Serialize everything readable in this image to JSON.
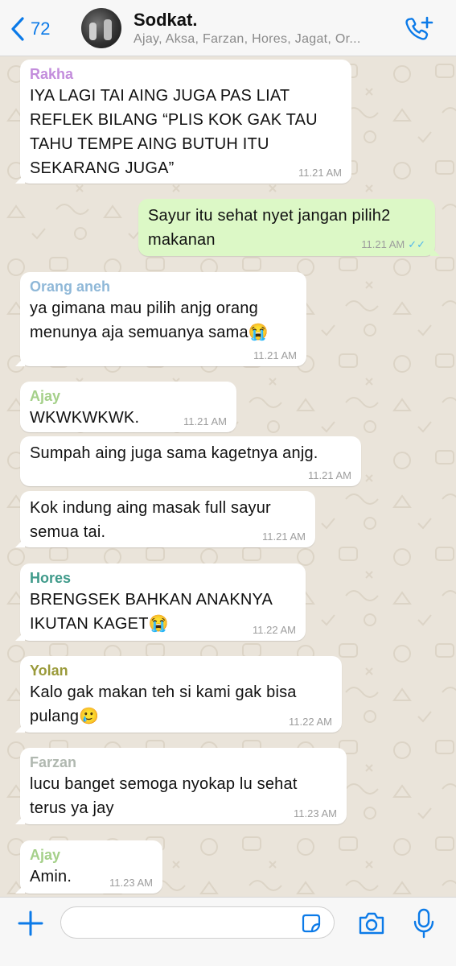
{
  "header": {
    "back_count": "72",
    "title": "Sodkat.",
    "subtitle": "Ajay, Aksa, Farzan, Hores, Jagat, Or...",
    "icons": {
      "back": "chevron-left-icon",
      "avatar": "group-avatar",
      "call": "add-call-icon"
    },
    "accent_color": "#0b7ae8"
  },
  "messages": [
    {
      "sender": "Rakha",
      "sender_color": "#c38ddc",
      "text": "IYA LAGI TAI AING JUGA PAS LIAT\nREFLEK BILANG “PLIS KOK GAK TAU\nTAHU TEMPE AING BUTUH ITU\nSEKARANG JUGA”",
      "time": "11.21 AM",
      "direction": "in"
    },
    {
      "sender": "",
      "text": "Sayur itu sehat nyet jangan pilih2\nmakanan",
      "time": "11.21 AM",
      "direction": "out",
      "ticks": "✓✓"
    },
    {
      "sender": "Orang aneh",
      "sender_color": "#8fb8d8",
      "text": "ya gimana mau pilih anjg orang\nmenunya aja semuanya sama😭",
      "time": "11.21 AM",
      "direction": "in"
    },
    {
      "sender": "Ajay",
      "sender_color": "#a5d08a",
      "text": "WKWKWKWK.",
      "time": "11.21 AM",
      "direction": "in"
    },
    {
      "sender": "",
      "text": "Sumpah aing juga sama kagetnya anjg.",
      "time": "11.21 AM",
      "direction": "in"
    },
    {
      "sender": "",
      "text": "Kok indung aing masak full sayur\nsemua tai.",
      "time": "11.21 AM",
      "direction": "in"
    },
    {
      "sender": "Hores",
      "sender_color": "#3f9a8a",
      "text": "BRENGSEK BAHKAN ANAKNYA\nIKUTAN KAGET😭",
      "time": "11.22 AM",
      "direction": "in"
    },
    {
      "sender": "Yolan",
      "sender_color": "#9a9a3a",
      "text": "Kalo gak makan teh si kami gak bisa\npulang🥲",
      "time": "11.22 AM",
      "direction": "in"
    },
    {
      "sender": "Farzan",
      "sender_color": "#b0b8b0",
      "text": "lucu banget semoga nyokap lu sehat\nterus ya jay",
      "time": "11.23 AM",
      "direction": "in"
    },
    {
      "sender": "Ajay",
      "sender_color": "#a5d08a",
      "text": "Amin.",
      "time": "11.23 AM",
      "direction": "in"
    }
  ],
  "footer": {
    "input_value": "",
    "icons": {
      "attach": "plus-icon",
      "sticker": "sticker-icon",
      "camera": "camera-icon",
      "mic": "microphone-icon"
    }
  },
  "colors": {
    "outgoing_bubble": "#dcf8c6",
    "incoming_bubble": "#ffffff",
    "read_ticks": "#4fb6ec",
    "chat_background": "#eae4da"
  }
}
